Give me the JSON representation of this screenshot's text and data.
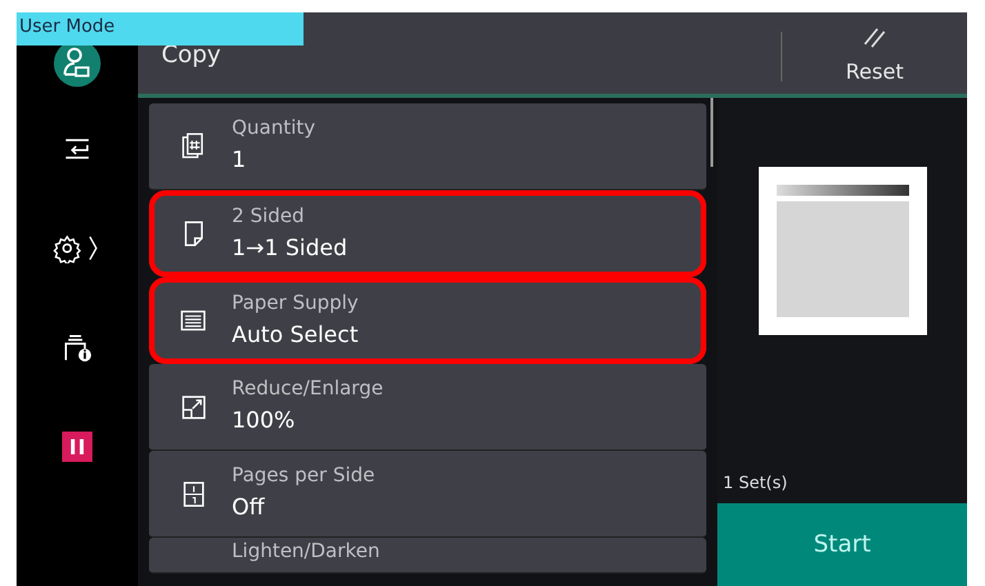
{
  "mode_badge": "User Mode",
  "header": {
    "title": "Copy",
    "reset": "Reset"
  },
  "features": [
    {
      "label": "Quantity",
      "value": "1",
      "highlighted": false
    },
    {
      "label": "2 Sided",
      "value": "1→1 Sided",
      "highlighted": true
    },
    {
      "label": "Paper Supply",
      "value": "Auto Select",
      "highlighted": true
    },
    {
      "label": "Reduce/Enlarge",
      "value": "100%",
      "highlighted": false
    },
    {
      "label": "Pages per Side",
      "value": "Off",
      "highlighted": false
    },
    {
      "label": "Lighten/Darken",
      "highlighted": false
    }
  ],
  "preview": {
    "sets": "1 Set(s)",
    "start": "Start"
  }
}
